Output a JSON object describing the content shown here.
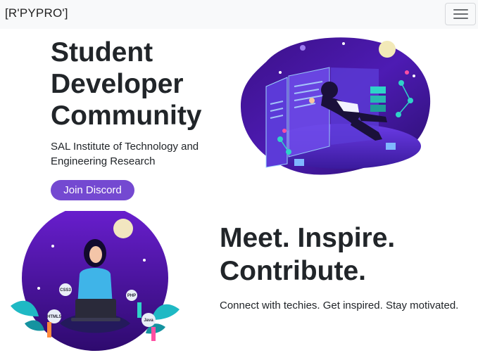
{
  "navbar": {
    "brand": "[R'PYPRO']",
    "toggler_icon": "hamburger-icon"
  },
  "hero": {
    "title_lines": [
      "Student",
      "Developer",
      "Community"
    ],
    "subtitle_lines": [
      "SAL Institute of Technology and",
      "Engineering Research"
    ],
    "button_label": "Join Discord",
    "button_color": "#7449d1"
  },
  "section2": {
    "title_lines": [
      "Meet. Inspire.",
      "Contribute."
    ],
    "subtitle": "Connect with techies. Get inspired. Stay motivated."
  },
  "illustrations": {
    "top": "virtual-reality-illustration",
    "bottom": "developer-with-laptop-illustration",
    "badges": [
      "CSS3",
      "HTML5",
      "PHP",
      "Java"
    ]
  },
  "colors": {
    "navbar_bg": "#f8f9fa",
    "purple_dark": "#3a0ca3",
    "purple_main": "#6a1fd1",
    "teal": "#1fb9c4"
  }
}
